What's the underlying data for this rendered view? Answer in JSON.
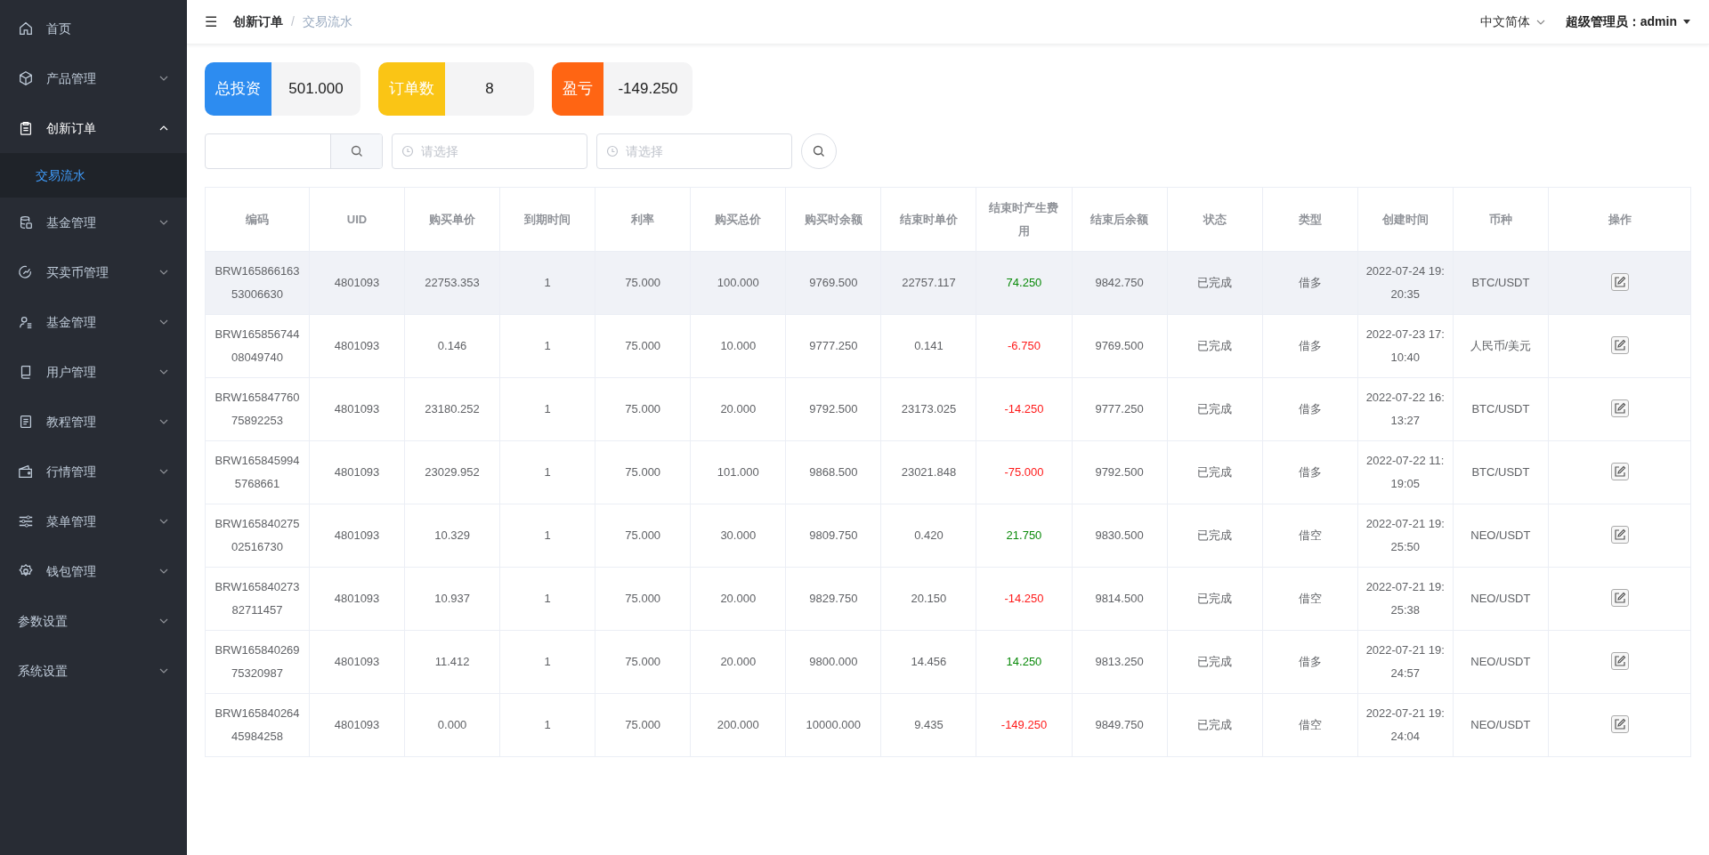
{
  "sidebar": {
    "items": [
      {
        "label": "首页",
        "kind": "link"
      },
      {
        "label": "产品管理",
        "kind": "submenu",
        "expanded": false
      },
      {
        "label": "创新订单",
        "kind": "submenu",
        "expanded": true,
        "children": [
          {
            "label": "交易流水",
            "selected": true
          }
        ]
      },
      {
        "label": "基金管理",
        "kind": "submenu",
        "expanded": false
      },
      {
        "label": "买卖币管理",
        "kind": "submenu",
        "expanded": false
      },
      {
        "label": "基金管理",
        "kind": "submenu",
        "expanded": false
      },
      {
        "label": "用户管理",
        "kind": "submenu",
        "expanded": false
      },
      {
        "label": "教程管理",
        "kind": "submenu",
        "expanded": false
      },
      {
        "label": "行情管理",
        "kind": "submenu",
        "expanded": false
      },
      {
        "label": "菜单管理",
        "kind": "submenu",
        "expanded": false
      },
      {
        "label": "钱包管理",
        "kind": "submenu",
        "expanded": false
      },
      {
        "label": "参数设置",
        "kind": "submenu",
        "expanded": false
      },
      {
        "label": "系统设置",
        "kind": "submenu",
        "expanded": false
      }
    ]
  },
  "header": {
    "menu_glyph": "☰",
    "breadcrumb": [
      "创新订单",
      "交易流水"
    ],
    "breadcrumb_separator": "/",
    "language": "中文简体",
    "user": "超级管理员：admin"
  },
  "stats": [
    {
      "label": "总投资",
      "value": "501.000",
      "color": "#2d8cf0"
    },
    {
      "label": "订单数",
      "value": "8",
      "color": "#fac515"
    },
    {
      "label": "盈亏",
      "value": "-149.250",
      "color": "#ff6513"
    }
  ],
  "filters": {
    "date_start": {
      "placeholder": "请选择"
    },
    "date_end": {
      "placeholder": "请选择"
    }
  },
  "table": {
    "columns": [
      "编码",
      "UID",
      "购买单价",
      "到期时间",
      "利率",
      "购买总价",
      "购买时余额",
      "结束时单价",
      "结束时产生费用",
      "结束后余额",
      "状态",
      "类型",
      "创建时间",
      "币种",
      "操作"
    ],
    "rows": [
      {
        "selected": true,
        "color": "#0a8a0a",
        "cells": [
          "BRW16586616353006630",
          "4801093",
          "22753.353",
          "1",
          "75.000",
          "100.000",
          "9769.500",
          "22757.117",
          "74.250",
          "9842.750",
          "已完成",
          "借多",
          "2022-07-24 19:20:35",
          "BTC/USDT"
        ]
      },
      {
        "selected": false,
        "color": "#ff1a1a",
        "cells": [
          "BRW16585674408049740",
          "4801093",
          "0.146",
          "1",
          "75.000",
          "10.000",
          "9777.250",
          "0.141",
          "-6.750",
          "9769.500",
          "已完成",
          "借多",
          "2022-07-23 17:10:40",
          "人民币/美元"
        ]
      },
      {
        "selected": false,
        "color": "#ff1a1a",
        "cells": [
          "BRW16584776075892253",
          "4801093",
          "23180.252",
          "1",
          "75.000",
          "20.000",
          "9792.500",
          "23173.025",
          "-14.250",
          "9777.250",
          "已完成",
          "借多",
          "2022-07-22 16:13:27",
          "BTC/USDT"
        ]
      },
      {
        "selected": false,
        "color": "#ff1a1a",
        "cells": [
          "BRW1658459945768661",
          "4801093",
          "23029.952",
          "1",
          "75.000",
          "101.000",
          "9868.500",
          "23021.848",
          "-75.000",
          "9792.500",
          "已完成",
          "借多",
          "2022-07-22 11:19:05",
          "BTC/USDT"
        ]
      },
      {
        "selected": false,
        "color": "#0a8a0a",
        "cells": [
          "BRW16584027502516730",
          "4801093",
          "10.329",
          "1",
          "75.000",
          "30.000",
          "9809.750",
          "0.420",
          "21.750",
          "9830.500",
          "已完成",
          "借空",
          "2022-07-21 19:25:50",
          "NEO/USDT"
        ]
      },
      {
        "selected": false,
        "color": "#ff1a1a",
        "cells": [
          "BRW16584027382711457",
          "4801093",
          "10.937",
          "1",
          "75.000",
          "20.000",
          "9829.750",
          "20.150",
          "-14.250",
          "9814.500",
          "已完成",
          "借空",
          "2022-07-21 19:25:38",
          "NEO/USDT"
        ]
      },
      {
        "selected": false,
        "color": "#0a8a0a",
        "cells": [
          "BRW16584026975320987",
          "4801093",
          "11.412",
          "1",
          "75.000",
          "20.000",
          "9800.000",
          "14.456",
          "14.250",
          "9813.250",
          "已完成",
          "借多",
          "2022-07-21 19:24:57",
          "NEO/USDT"
        ]
      },
      {
        "selected": false,
        "color": "#ff1a1a",
        "cells": [
          "BRW16584026445984258",
          "4801093",
          "0.000",
          "1",
          "75.000",
          "200.000",
          "10000.000",
          "9.435",
          "-149.250",
          "9849.750",
          "已完成",
          "借空",
          "2022-07-21 19:24:04",
          "NEO/USDT"
        ]
      }
    ]
  }
}
